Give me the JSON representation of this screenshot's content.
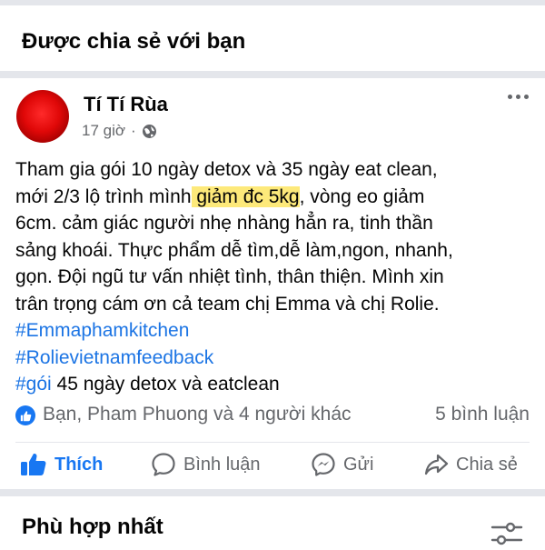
{
  "section": {
    "title": "Được chia sẻ với bạn"
  },
  "post": {
    "author": "Tí Tí Rùa",
    "time": "17 giờ",
    "separator": "·",
    "audience_icon": "globe-icon",
    "more_icon": "more-horizontal-icon",
    "text_lines": {
      "l1": "Tham gia gói 10 ngày detox và 35 ngày eat clean,",
      "l2_a": "mới 2/3 lộ trình mình",
      "l2_b": " giảm đc 5kg",
      "l2_c": ", vòng eo giảm",
      "l3": "6cm.  cảm giác người nhẹ nhàng hẳn ra, tinh thần",
      "l4": "sảng khoái. Thực phẩm dễ tìm,dễ làm,ngon, nhanh,",
      "l5": "gọn. Đội ngũ tư vấn nhiệt tình, thân thiện. Mình xin",
      "l6": "trân trọng cám ơn cả team chị Emma và chị Rolie."
    },
    "hashtags": {
      "h1": " #Emmaphamkitchen",
      "h2": "#Rolievietnamfeedback",
      "h3_tag": "#gói",
      "h3_rest": " 45 ngày detox và eatclean"
    },
    "highlight_color": "#fde97a",
    "hashtag_color": "#1b74e4",
    "reactions": {
      "text": "Bạn, Pham Phuong và 4 người khác",
      "comments": "5 bình luận"
    },
    "actions": {
      "like": "Thích",
      "comment": "Bình luận",
      "send": "Gửi",
      "share": "Chia sẻ"
    },
    "like_color": "#1877f2"
  },
  "comments_section": {
    "sort_label": "Phù hợp nhất",
    "filter_icon": "sliders-icon"
  }
}
